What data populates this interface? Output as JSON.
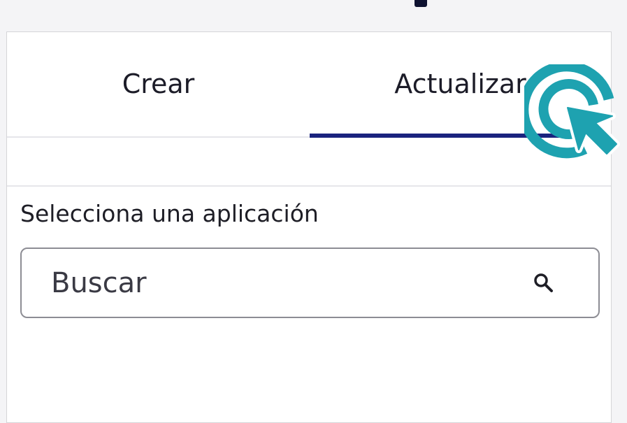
{
  "tabs": [
    {
      "label": "Crear",
      "active": false
    },
    {
      "label": "Actualizar",
      "active": true
    }
  ],
  "form": {
    "label": "Selecciona una aplicación",
    "search_placeholder": "Buscar",
    "search_value": ""
  },
  "icons": {
    "search": "search-icon",
    "click_indicator": "click-cursor-icon"
  },
  "colors": {
    "active_tab_indicator": "#1a237e",
    "click_indicator": "#1ea2b0"
  }
}
